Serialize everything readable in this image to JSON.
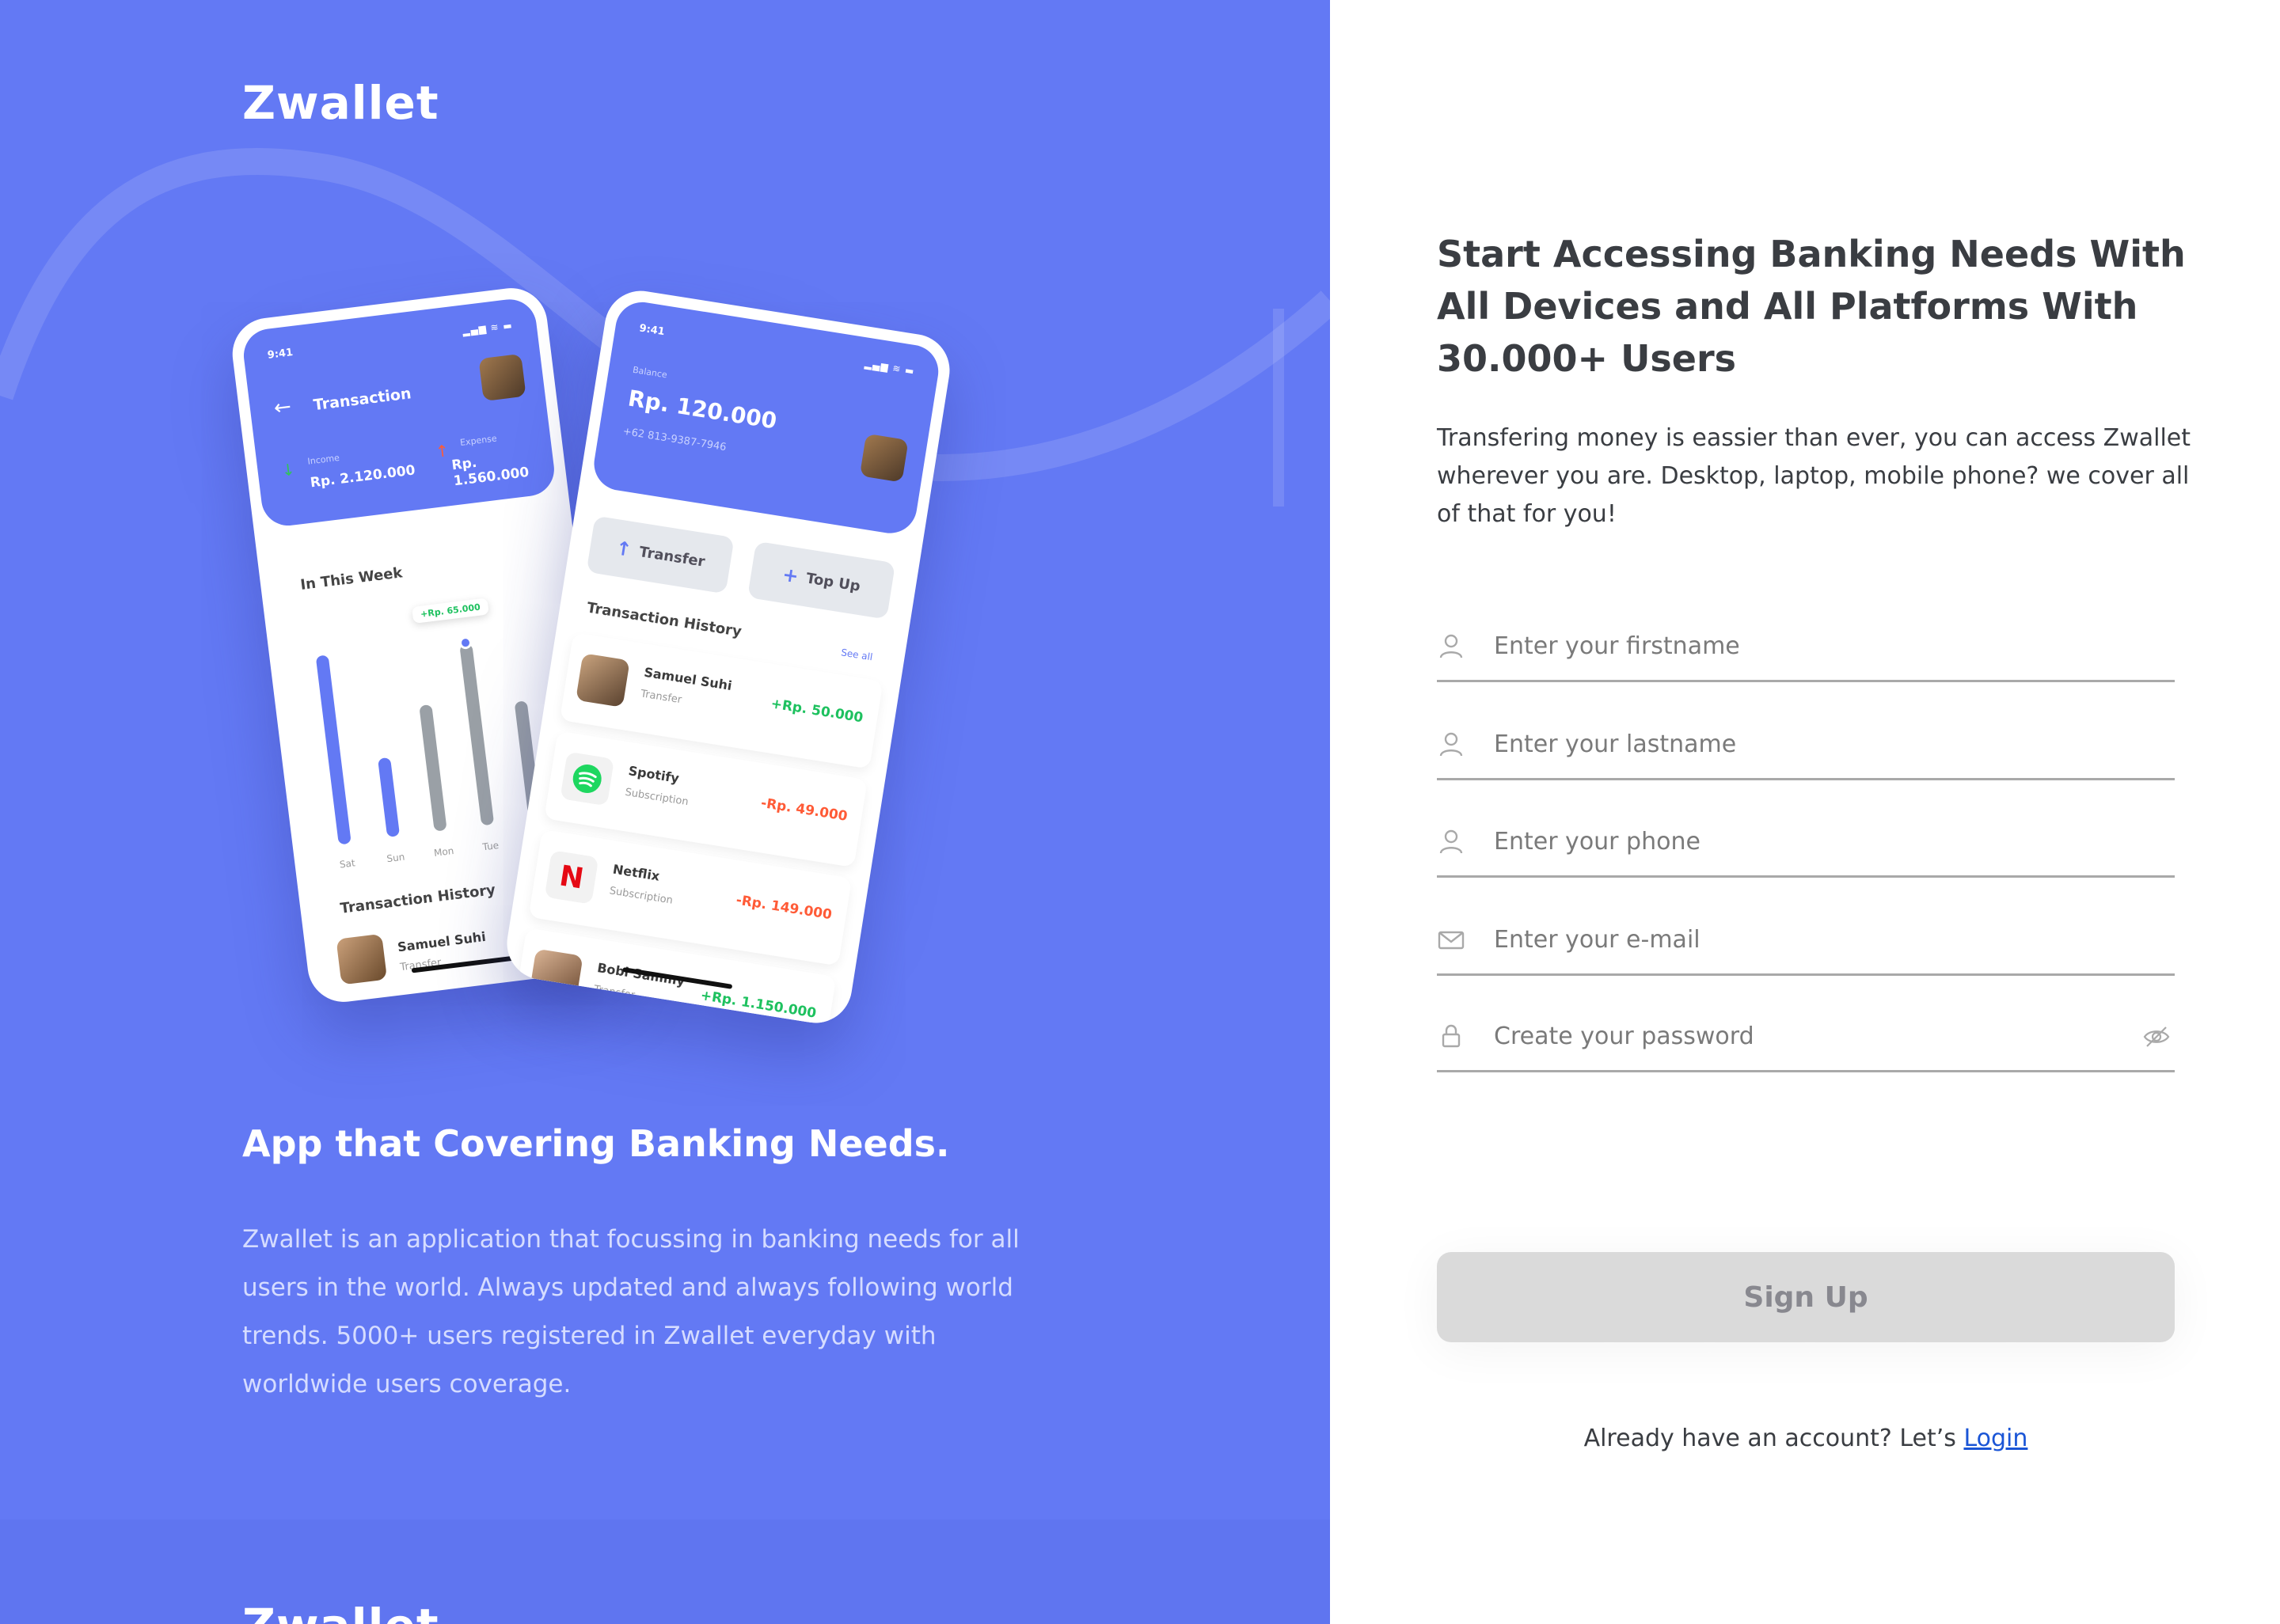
{
  "brand": {
    "name": "Zwallet"
  },
  "left_panel": {
    "heading": "App that Covering Banking Needs.",
    "description": "Zwallet is an application that focussing in banking needs for all users in the world. Always updated and always following world trends. 5000+ users registered in Zwallet everyday with worldwide users coverage.",
    "background_color": "#6379f4"
  },
  "phone1": {
    "time": "9:41",
    "signal": "▂▄▆ ≋ ▬",
    "back_icon": "arrow-left-icon",
    "title": "Transaction",
    "income_label": "Income",
    "income_value": "Rp. 2.120.000",
    "expense_label": "Expense",
    "expense_value": "Rp. 1.560.000",
    "week_title": "In This Week",
    "tooltip": "+Rp. 65.000",
    "days": [
      "Sat",
      "Sun",
      "Mon",
      "Tue"
    ],
    "history_title": "Transaction History",
    "history_name": "Samuel Suhi",
    "history_type": "Transfer"
  },
  "phone2": {
    "time": "9:41",
    "signal": "▂▄▆ ≋ ▬",
    "balance_label": "Balance",
    "balance_value": "Rp. 120.000",
    "phone_number": "+62 813-9387-7946",
    "transfer_label": "Transfer",
    "topup_label": "Top Up",
    "history_title": "Transaction History",
    "see_all": "See all",
    "transactions": [
      {
        "name": "Samuel Suhi",
        "type": "Transfer",
        "amount": "+Rp. 50.000",
        "icon": "avatar-icon"
      },
      {
        "name": "Spotify",
        "type": "Subscription",
        "amount": "-Rp. 49.000",
        "icon": "spotify-icon"
      },
      {
        "name": "Netflix",
        "type": "Subscription",
        "amount": "-Rp. 149.000",
        "icon": "netflix-icon"
      },
      {
        "name": "Bobi Sammy",
        "type": "Transfer",
        "amount": "+Rp. 1.150.000",
        "icon": "avatar-icon"
      }
    ]
  },
  "form": {
    "heading": "Start Accessing Banking Needs With All Devices and All Platforms With 30.000+ Users",
    "description": "Transfering money is eassier than ever, you can access Zwallet wherever you are. Desktop, laptop, mobile phone? we cover all of that for you!",
    "fields": [
      {
        "placeholder": "Enter your firstname",
        "value": "",
        "icon": "user-icon"
      },
      {
        "placeholder": "Enter your lastname",
        "value": "",
        "icon": "user-icon"
      },
      {
        "placeholder": "Enter your phone",
        "value": "",
        "icon": "user-icon"
      },
      {
        "placeholder": "Enter your e-mail",
        "value": "",
        "icon": "mail-icon"
      },
      {
        "placeholder": "Create your password",
        "value": "",
        "icon": "lock-icon"
      }
    ],
    "submit_label": "Sign Up",
    "login_prompt": "Already have an account? Let’s",
    "login_link": "Login"
  }
}
